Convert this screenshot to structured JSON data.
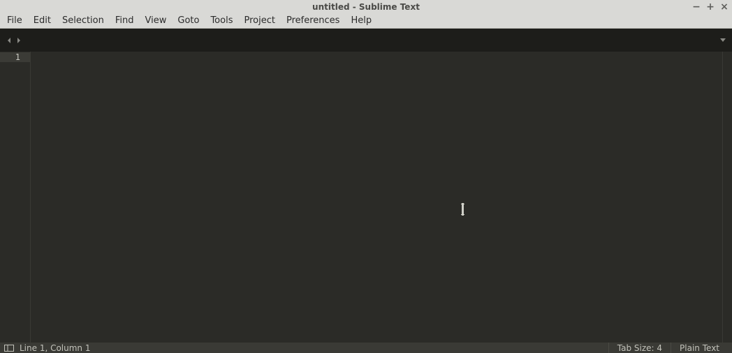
{
  "window": {
    "title": "untitled - Sublime Text"
  },
  "menu": {
    "items": [
      "File",
      "Edit",
      "Selection",
      "Find",
      "View",
      "Goto",
      "Tools",
      "Project",
      "Preferences",
      "Help"
    ]
  },
  "editor": {
    "line_numbers": [
      "1"
    ]
  },
  "status": {
    "position": "Line 1, Column 1",
    "tab_size": "Tab Size: 4",
    "syntax": "Plain Text"
  }
}
